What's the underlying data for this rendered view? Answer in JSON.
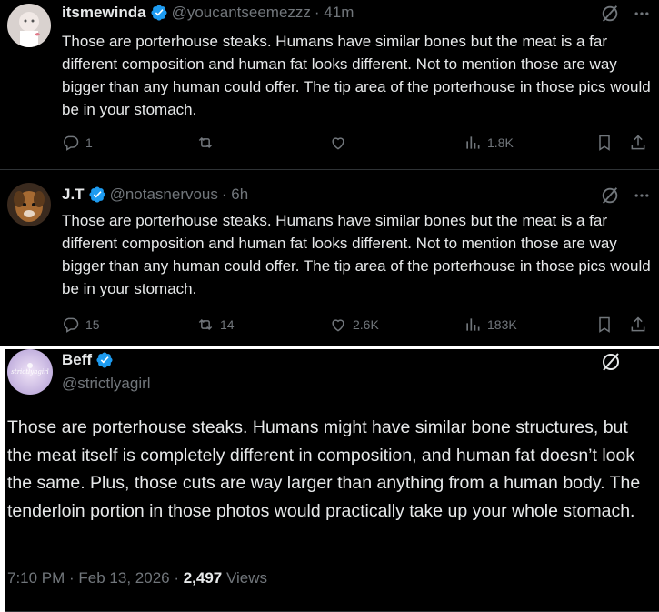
{
  "tweets": [
    {
      "name": "itsmewinda",
      "handle": "@youcantseemezzz",
      "time": "· 41m",
      "text": "Those are porterhouse steaks. Humans have similar bones but the meat is a far different composition and human fat looks different. Not to mention those are way bigger than any human could offer. The tip area of the porterhouse in those pics would be in your stomach.",
      "replies": "1",
      "reposts": "",
      "likes": "",
      "views": "1.8K"
    },
    {
      "name": "J.T",
      "handle": "@notasnervous",
      "time": "· 6h",
      "text": "Those are porterhouse steaks. Humans have similar bones but the meat is a far different composition and human fat looks different. Not to mention those are way bigger than any human could offer. The tip area of the porterhouse in those pics would be in your stomach.",
      "replies": "15",
      "reposts": "14",
      "likes": "2.6K",
      "views": "183K"
    }
  ],
  "main": {
    "name": "Beff",
    "handle": "@strictlyagirl",
    "avatar_text": "strictlyagirl",
    "text": "Those are porterhouse steaks. Humans might have similar bone structures, but the meat itself is completely different in composition, and human fat doesn’t look the same. Plus, those cuts are way larger than anything from a human body. The tenderloin portion in those photos would practically take up your whole stomach.",
    "timestamp": "7:10 PM · Feb 13, 2026 · ",
    "views_count": "2,497",
    "views_label": " Views"
  },
  "colors": {
    "background": "#000000",
    "text": "#e7e9ea",
    "muted": "#71767b",
    "verified": "#1d9bf0",
    "border": "#2f3336"
  }
}
